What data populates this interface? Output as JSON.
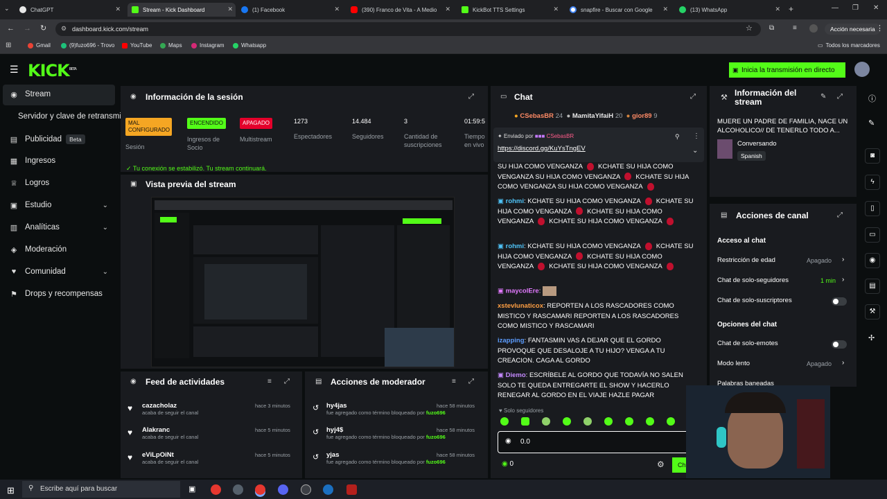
{
  "browser": {
    "tabs": [
      {
        "title": "ChatGPT",
        "color": "#e8e8e8"
      },
      {
        "title": "Stream - Kick Dashboard",
        "color": "#53fc18"
      },
      {
        "title": "(1) Facebook",
        "color": "#1877f2"
      },
      {
        "title": "(390) Franco de Vita - A Medio",
        "color": "#ff0000"
      },
      {
        "title": "KickBot TTS Settings",
        "color": "#53fc18"
      },
      {
        "title": "snapfire - Buscar con Google",
        "color": "#ffffff"
      },
      {
        "title": "(13) WhatsApp",
        "color": "#25d366"
      }
    ],
    "url": "dashboard.kick.com/stream",
    "action_button": "Acción necesaria",
    "bookmarks": [
      "Gmail",
      "(9)fuzo696 - Trovo",
      "YouTube",
      "Maps",
      "Instagram",
      "Whatsapp"
    ],
    "bookmarks_all": "Todos los marcadores"
  },
  "header": {
    "logo": "KICK",
    "logo_sup": "BETA",
    "go_live": "Inicia la transmisión en directo"
  },
  "sidebar": {
    "items": [
      {
        "label": "Stream",
        "icon": "broadcast-icon"
      },
      {
        "label": "Servidor y clave de retransmisión",
        "icon": ""
      },
      {
        "label": "Publicidad",
        "icon": "ad-icon",
        "badge": "Beta"
      },
      {
        "label": "Ingresos",
        "icon": "revenue-icon"
      },
      {
        "label": "Logros",
        "icon": "trophy-icon"
      },
      {
        "label": "Estudio",
        "icon": "studio-icon"
      },
      {
        "label": "Analíticas",
        "icon": "analytics-icon"
      },
      {
        "label": "Moderación",
        "icon": "moderation-icon"
      },
      {
        "label": "Comunidad",
        "icon": "community-icon"
      },
      {
        "label": "Drops y recompensas",
        "icon": "drops-icon"
      }
    ]
  },
  "session": {
    "title": "Información de la sesión",
    "stats": [
      {
        "pill": "MAL CONFIGURADO",
        "label": "Sesión"
      },
      {
        "pill": "ENCENDIDO",
        "label": "Ingresos de Socio"
      },
      {
        "pill": "APAGADO",
        "label": "Multistream"
      },
      {
        "value": "1273",
        "label": "Espectadores"
      },
      {
        "value": "14.484",
        "label": "Seguidores"
      },
      {
        "value": "3",
        "label": "Cantidad de suscripciones"
      },
      {
        "value": "01:59:5",
        "label": "Tiempo en vivo"
      }
    ],
    "notice": "Tu conexión se estabilizó. Tu stream continuará."
  },
  "preview": {
    "title": "Vista previa del stream"
  },
  "feed": {
    "title": "Feed de actividades",
    "items": [
      {
        "name": "cazacholaz",
        "sub": "acaba de seguir el canal",
        "time": "hace 3 minutos"
      },
      {
        "name": "Alakranc",
        "sub": "acaba de seguir el canal",
        "time": "hace 5 minutos"
      },
      {
        "name": "eViLpOiNt",
        "sub": "acaba de seguir el canal",
        "time": "hace 5 minutos"
      }
    ]
  },
  "modactions": {
    "title": "Acciones de moderador",
    "items": [
      {
        "name": "hy4jas",
        "sub": "fue agregado como término bloqueado por",
        "by": "fuzo696",
        "time": "hace 58 minutos"
      },
      {
        "name": "hyj4$",
        "sub": "fue agregado como término bloqueado por",
        "by": "fuzo696",
        "time": "hace 58 minutos"
      },
      {
        "name": "yjas",
        "sub": "fue agregado como término bloqueado por",
        "by": "fuzo696",
        "time": "hace 58 minutos"
      }
    ]
  },
  "chat": {
    "title": "Chat",
    "top_gifters": [
      {
        "name": "CSebasBR",
        "count": "24"
      },
      {
        "name": "MamitaYifaiH",
        "count": "20"
      },
      {
        "name": "gior89",
        "count": "9"
      }
    ],
    "pinned": {
      "label": "Enviado por",
      "user": "CSebasBR",
      "link": "https://discord.gg/KuYsTngEV"
    },
    "messages": [
      {
        "user": "",
        "text": "SU HIJA COMO VENGANZA",
        "color": "#ffffff"
      },
      {
        "user": "rohmi",
        "text": "KCHATE SU HIJA COMO VENGANZA",
        "color": "#4fc3f7"
      },
      {
        "user": "rohmi",
        "text": "KCHATE SU HIJA COMO VENGANZA",
        "color": "#4fc3f7"
      },
      {
        "user": "maycolEre",
        "text": "",
        "color": "#e27aff"
      },
      {
        "user": "xstevlunaticox",
        "text": "REPORTEN A LOS RASCADORES COMO MISTICO Y RASCAMARI REPORTEN A LOS RASCADORES COMO MISTICO Y RASCAMARI",
        "color": "#ff9f43"
      },
      {
        "user": "izapping",
        "text": "FANTASMIN VAS A DEJAR QUE EL GORDO PROVOQUE QUE DESALOJE A TU HIJO? VENGA A TU CREACION. CAGA AL GORDO",
        "color": "#5c9dff"
      },
      {
        "user": "Diemo",
        "text": "ESCRÍBELE AL GORDO QUE TODAVÍA NO SALEN SOLO TE QUEDA ENTREGARTE EL SHOW Y HACERLO RENEGAR AL GORDO EN EL VIAJE HAZLE PAGAR",
        "color": "#c58aff"
      }
    ],
    "line_text": "KCHATE SU HIJA COMO VENGANZA",
    "followers_only": "Solo seguidores",
    "input_value": "0.0",
    "points": "0",
    "send": "Chat"
  },
  "stream_info": {
    "title": "Información del stream",
    "stream_title": "MUERE UN PADRE DE FAMILIA, NACE UN ALCOHOLICO// DE TENERLO TODO A...",
    "category": "Conversando",
    "language": "Spanish"
  },
  "channel_actions": {
    "title": "Acciones de canal",
    "chat_access": "Acceso al chat",
    "age_restriction": "Restricción de edad",
    "age_value": "Apagado",
    "followers_chat": "Chat de solo-seguidores",
    "followers_value": "1 min",
    "subs_chat": "Chat de solo-suscriptores",
    "chat_options": "Opciones del chat",
    "emotes_chat": "Chat de solo-emotes",
    "slow_mode": "Modo lento",
    "slow_value": "Apagado",
    "banned_words": "Palabras baneadas"
  },
  "taskbar": {
    "search": "Escribe aquí para buscar"
  }
}
